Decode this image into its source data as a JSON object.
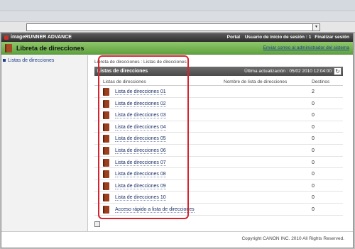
{
  "browser": {
    "dropdown_glyph": "▾"
  },
  "brand": {
    "name": "imageRUNNER ADVANCE"
  },
  "topbar": {
    "portal": "Portal",
    "user": "Usuario de inicio de sesión : 1",
    "logout": "Finalizar sesión"
  },
  "page": {
    "title": "Libreta de direcciones",
    "mail_admin": "Enviar correo al administrador del sistema"
  },
  "sidebar": {
    "items": [
      {
        "label": "Listas de direcciones"
      }
    ]
  },
  "breadcrumb": "Libreta de direcciones : Listas de direcciones",
  "section": {
    "title": "Listas de direcciones",
    "updated": "Última actualización : 05/02 2010 12:04:00",
    "refresh_glyph": "↻"
  },
  "table": {
    "headers": [
      "Listas de direcciones",
      "Nombre de lista de direcciones",
      "Destinos"
    ],
    "rows": [
      {
        "name": "Lista de direcciones 01",
        "dest": "2"
      },
      {
        "name": "Lista de direcciones 02",
        "dest": "0"
      },
      {
        "name": "Lista de direcciones 03",
        "dest": "0"
      },
      {
        "name": "Lista de direcciones 04",
        "dest": "0"
      },
      {
        "name": "Lista de direcciones 05",
        "dest": "0"
      },
      {
        "name": "Lista de direcciones 06",
        "dest": "0"
      },
      {
        "name": "Lista de direcciones 07",
        "dest": "0"
      },
      {
        "name": "Lista de direcciones 08",
        "dest": "0"
      },
      {
        "name": "Lista de direcciones 09",
        "dest": "0"
      },
      {
        "name": "Lista de direcciones 10",
        "dest": "0"
      },
      {
        "name": "Acceso rápido a lista de direcciones",
        "dest": "0"
      }
    ]
  },
  "footer": {
    "copyright": "Copyright CANON INC. 2010 All Rights Reserved."
  },
  "colors": {
    "highlight": "#d6242f",
    "title_bar": "#6aa845",
    "link": "#1b2f66"
  }
}
